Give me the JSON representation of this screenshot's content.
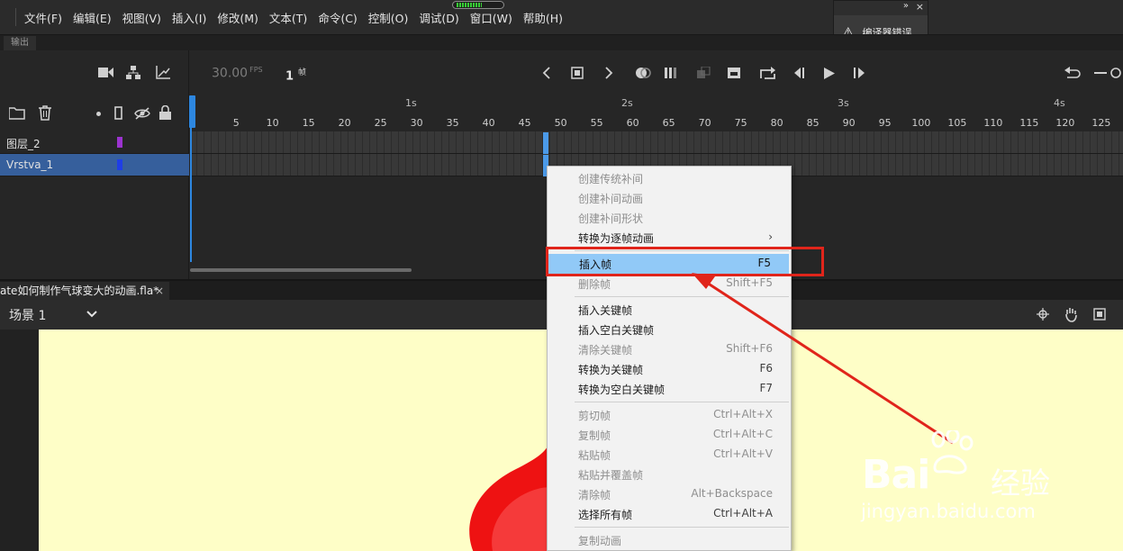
{
  "menubar": {
    "items": [
      "文件(F)",
      "编辑(E)",
      "视图(V)",
      "插入(I)",
      "修改(M)",
      "文本(T)",
      "命令(C)",
      "控制(O)",
      "调试(D)",
      "窗口(W)",
      "帮助(H)"
    ]
  },
  "error_panel": {
    "label": "编译器错误",
    "collapse": "»",
    "close": "×"
  },
  "panel_tab": {
    "label": "输出"
  },
  "timeline": {
    "fps_value": "30.00",
    "fps_unit": "FPS",
    "current_frame": "1",
    "frame_unit": "帧",
    "seconds": [
      "1s",
      "2s",
      "3s",
      "4s"
    ],
    "frame_numbers": [
      "5",
      "10",
      "15",
      "20",
      "25",
      "30",
      "35",
      "40",
      "45",
      "50",
      "55",
      "60",
      "65",
      "70",
      "75",
      "80",
      "85",
      "90",
      "95",
      "100",
      "105",
      "110",
      "115",
      "120",
      "125"
    ],
    "layers": [
      {
        "name": "图层_2",
        "color": "#9b33cf"
      },
      {
        "name": "Vrstva_1",
        "color": "#1f3ee6"
      }
    ]
  },
  "document": {
    "tab_label": "ate如何制作气球变大的动画.fla*",
    "close": "×"
  },
  "scene": {
    "label": "场景 1"
  },
  "context_menu": {
    "items": [
      {
        "label": "创建传统补间",
        "shortcut": "",
        "disabled": true
      },
      {
        "label": "创建补间动画",
        "shortcut": "",
        "disabled": true
      },
      {
        "label": "创建补间形状",
        "shortcut": "",
        "disabled": true
      },
      {
        "label": "转换为逐帧动画",
        "shortcut": "›",
        "disabled": false
      },
      {
        "label": "插入帧",
        "shortcut": "F5",
        "disabled": false,
        "highlighted": true
      },
      {
        "label": "删除帧",
        "shortcut": "Shift+F5",
        "disabled": true
      },
      {
        "label": "插入关键帧",
        "shortcut": "",
        "disabled": false
      },
      {
        "label": "插入空白关键帧",
        "shortcut": "",
        "disabled": false
      },
      {
        "label": "清除关键帧",
        "shortcut": "Shift+F6",
        "disabled": true
      },
      {
        "label": "转换为关键帧",
        "shortcut": "F6",
        "disabled": false
      },
      {
        "label": "转换为空白关键帧",
        "shortcut": "F7",
        "disabled": false
      },
      {
        "label": "剪切帧",
        "shortcut": "Ctrl+Alt+X",
        "disabled": true
      },
      {
        "label": "复制帧",
        "shortcut": "Ctrl+Alt+C",
        "disabled": true
      },
      {
        "label": "粘贴帧",
        "shortcut": "Ctrl+Alt+V",
        "disabled": true
      },
      {
        "label": "粘贴并覆盖帧",
        "shortcut": "",
        "disabled": true
      },
      {
        "label": "清除帧",
        "shortcut": "Alt+Backspace",
        "disabled": true
      },
      {
        "label": "选择所有帧",
        "shortcut": "Ctrl+Alt+A",
        "disabled": false
      },
      {
        "label": "复制动画",
        "shortcut": "",
        "disabled": true
      }
    ]
  },
  "watermark": {
    "brand": "Bai",
    "brand_suffix": "经验",
    "url": "jingyan.baidu.com"
  },
  "colors": {
    "highlight": "#91c9f7",
    "annotation_red": "#e0251b",
    "stage": "#fefec7",
    "playhead": "#2d87e0"
  }
}
